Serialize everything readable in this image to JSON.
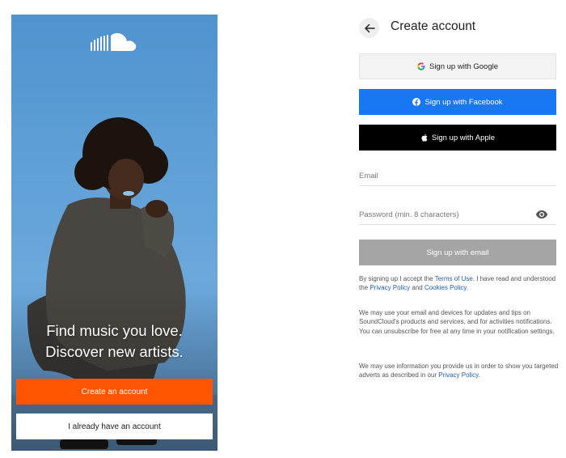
{
  "splash": {
    "tagline_line1": "Find music you love.",
    "tagline_line2": "Discover new artists.",
    "create_button": "Create an account",
    "login_button": "I already have an account",
    "logo_icon": "soundcloud-cloud-icon",
    "colors": {
      "accent": "#ff5500",
      "background": "#5fa0d6"
    }
  },
  "header": {
    "title": "Create account",
    "back_icon": "arrow-left-icon"
  },
  "social": {
    "google_label": "Sign up with Google",
    "facebook_label": "Sign up with Facebook",
    "apple_label": "Sign up with Apple",
    "colors": {
      "facebook": "#1877f2",
      "apple": "#000000"
    }
  },
  "form": {
    "email_placeholder": "Email",
    "password_placeholder": "Password (min. 8 characters)",
    "password_toggle_icon": "eye-icon",
    "submit_label": "Sign up with email"
  },
  "legal": {
    "p1_a": "By signing up I accept the ",
    "p1_terms": "Terms of Use",
    "p1_b": ". I have read and understood the ",
    "p1_privacy": "Privacy Policy",
    "p1_c": " and ",
    "p1_cookies": "Cookies Policy",
    "p1_d": ".",
    "p2": "We may use your email and devices for updates and tips on SoundCloud's products and services, and for activities notifications. You can unsubscribe for free at any time in your notification settings.",
    "p3_a": "We may use information you provide us in order to show you targeted adverts as described in our ",
    "p3_privacy": "Privacy Policy",
    "p3_b": "."
  }
}
